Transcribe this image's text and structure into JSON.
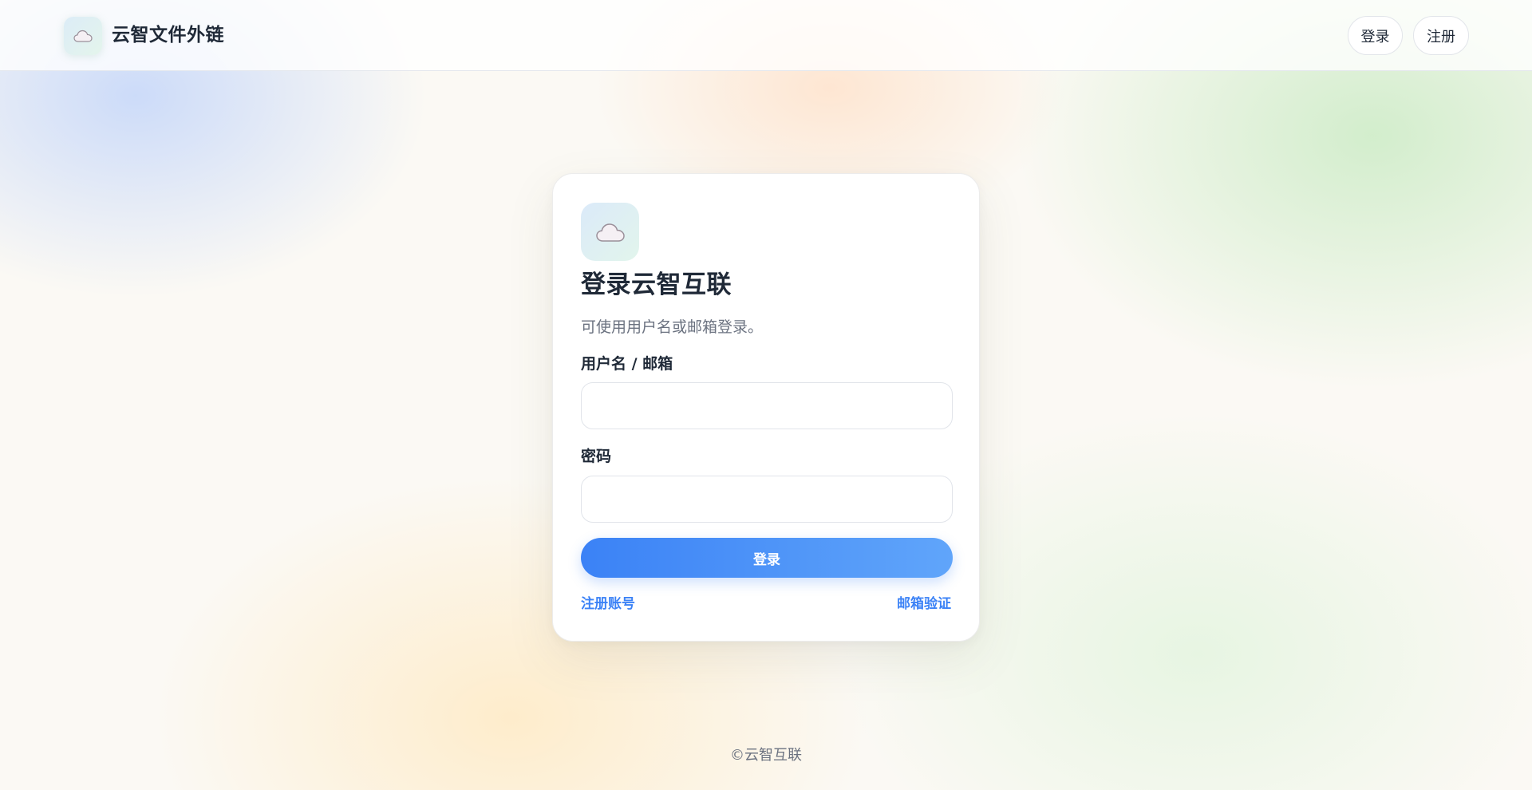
{
  "header": {
    "brand_name": "云智文件外链",
    "nav_login": "登录",
    "nav_register": "注册"
  },
  "card": {
    "title": "登录云智互联",
    "subtitle": "可使用用户名或邮箱登录。",
    "username_label": "用户名 / 邮箱",
    "username_value": "",
    "password_label": "密码",
    "password_value": "",
    "submit_label": "登录",
    "register_link": "注册账号",
    "verify_link": "邮箱验证"
  },
  "footer": {
    "copyright": "©云智互联"
  },
  "icons": {
    "brand": "cloud-icon",
    "card": "cloud-icon"
  },
  "colors": {
    "accent": "#3b82f6",
    "accent_light": "#60a5fa",
    "text": "#1f2937",
    "muted": "#6b7280"
  }
}
